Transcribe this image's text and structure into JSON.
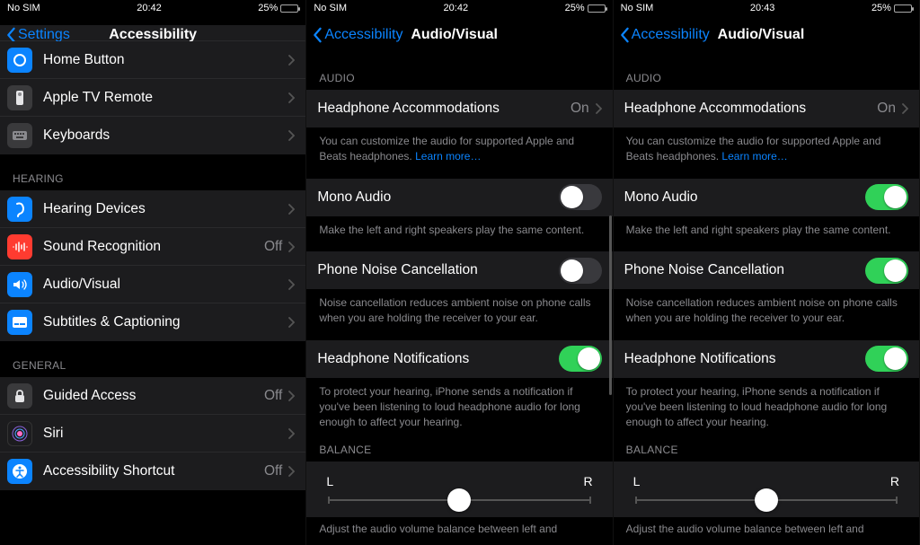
{
  "status": {
    "carrier": "No SIM",
    "battery_pct": "25%"
  },
  "screen1": {
    "time": "20:42",
    "back": "Settings",
    "title": "Accessibility",
    "rows": {
      "home_button": "Home Button",
      "apple_tv": "Apple TV Remote",
      "keyboards": "Keyboards"
    },
    "hearing_header": "HEARING",
    "hearing": {
      "devices": "Hearing Devices",
      "sound_rec": "Sound Recognition",
      "sound_rec_val": "Off",
      "audio_visual": "Audio/Visual",
      "subtitles": "Subtitles & Captioning"
    },
    "general_header": "GENERAL",
    "general": {
      "guided": "Guided Access",
      "guided_val": "Off",
      "siri": "Siri",
      "shortcut": "Accessibility Shortcut",
      "shortcut_val": "Off"
    }
  },
  "screen2": {
    "time": "20:42",
    "back": "Accessibility",
    "title": "Audio/Visual",
    "audio_header": "AUDIO",
    "headphone": "Headphone Accommodations",
    "headphone_val": "On",
    "headphone_foot": "You can customize the audio for supported Apple and Beats headphones. ",
    "learn_more": "Learn more…",
    "mono": "Mono Audio",
    "mono_foot": "Make the left and right speakers play the same content.",
    "noise": "Phone Noise Cancellation",
    "noise_foot": "Noise cancellation reduces ambient noise on phone calls when you are holding the receiver to your ear.",
    "notif": "Headphone Notifications",
    "notif_foot": "To protect your hearing, iPhone sends a notification if you've been listening to loud headphone audio for long enough to affect your hearing.",
    "balance_header": "BALANCE",
    "balance_l": "L",
    "balance_r": "R",
    "balance_foot": "Adjust the audio volume balance between left and"
  },
  "screen3": {
    "time": "20:43",
    "mono_on": true,
    "noise_on": true
  }
}
